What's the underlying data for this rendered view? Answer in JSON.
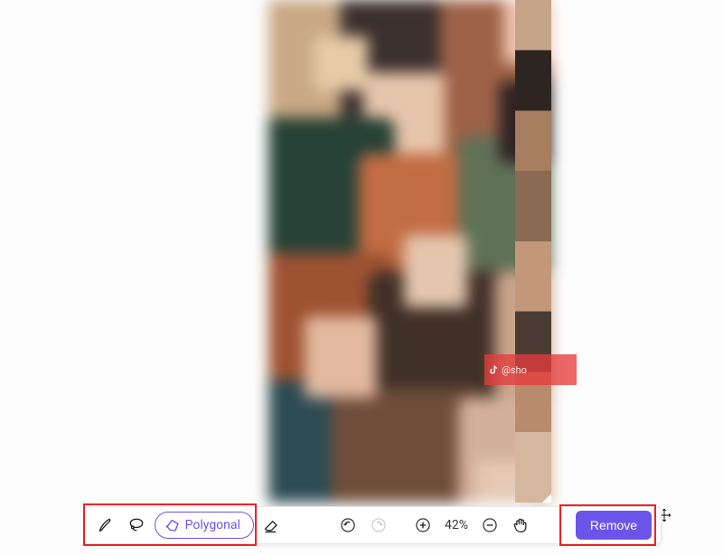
{
  "tools": {
    "brush": "brush",
    "lasso": "lasso",
    "polygonal_label": "Polygonal",
    "eraser": "eraser"
  },
  "history": {
    "undo": "undo",
    "redo": "redo"
  },
  "zoom": {
    "in": "zoom-in",
    "out": "zoom-out",
    "percent_label": "42%",
    "pan": "pan"
  },
  "actions": {
    "remove_label": "Remove"
  },
  "watermark": {
    "text": "@sho"
  },
  "colors": {
    "accent": "#6b54e9",
    "callout": "#e22"
  }
}
